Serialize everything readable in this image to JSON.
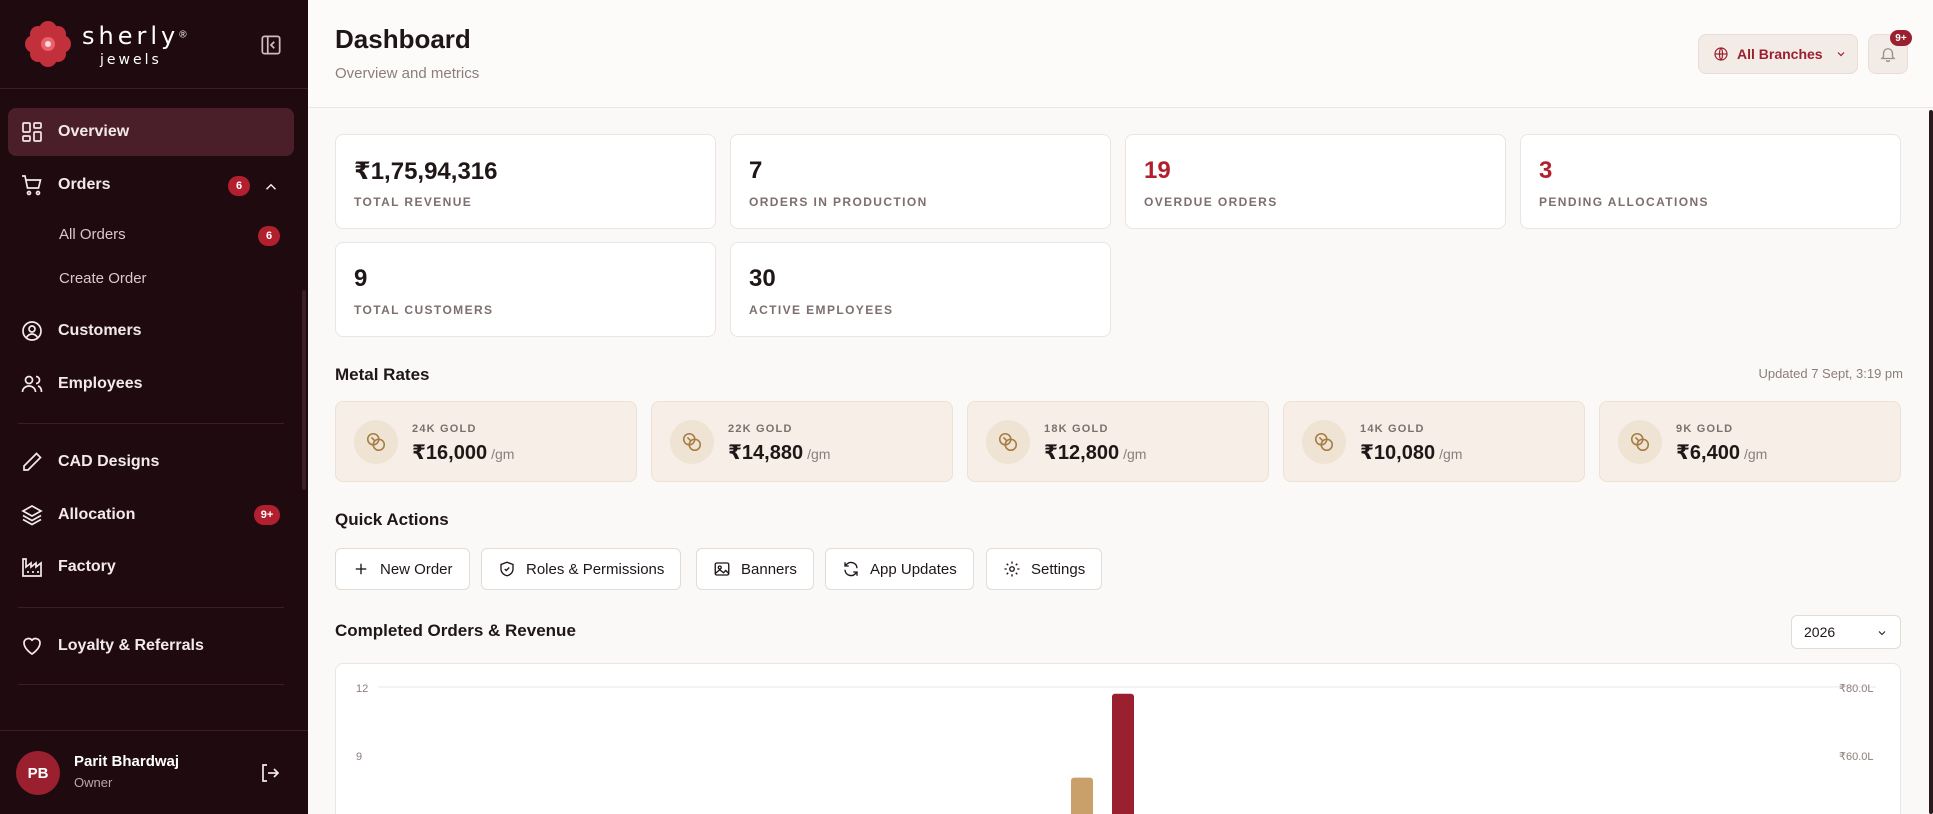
{
  "brand": {
    "name": "sherly",
    "tagline": "jewels",
    "reg": "®"
  },
  "sidebar": {
    "items": [
      {
        "label": "Overview"
      },
      {
        "label": "Orders",
        "badge": "6"
      },
      {
        "label": "Customers"
      },
      {
        "label": "Employees"
      },
      {
        "label": "CAD Designs"
      },
      {
        "label": "Allocation",
        "badge": "9+"
      },
      {
        "label": "Factory"
      },
      {
        "label": "Loyalty & Referrals"
      }
    ],
    "orders_sub": [
      {
        "label": "All Orders",
        "badge": "6"
      },
      {
        "label": "Create Order"
      }
    ]
  },
  "user": {
    "initials": "PB",
    "name": "Parit Bhardwaj",
    "role": "Owner"
  },
  "header": {
    "title": "Dashboard",
    "subtitle": "Overview and metrics",
    "branch": "All Branches",
    "notifications_badge": "9+"
  },
  "stats": [
    {
      "value": "₹1,75,94,316",
      "label": "TOTAL REVENUE"
    },
    {
      "value": "7",
      "label": "ORDERS IN PRODUCTION"
    },
    {
      "value": "19",
      "label": "OVERDUE ORDERS"
    },
    {
      "value": "3",
      "label": "PENDING ALLOCATIONS"
    },
    {
      "value": "9",
      "label": "TOTAL CUSTOMERS"
    },
    {
      "value": "30",
      "label": "ACTIVE EMPLOYEES"
    }
  ],
  "metal_rates": {
    "title": "Metal Rates",
    "updated": "Updated 7 Sept, 3:19 pm",
    "unit": "/gm",
    "items": [
      {
        "label": "24K GOLD",
        "value": "₹16,000"
      },
      {
        "label": "22K GOLD",
        "value": "₹14,880"
      },
      {
        "label": "18K GOLD",
        "value": "₹12,800"
      },
      {
        "label": "14K GOLD",
        "value": "₹10,080"
      },
      {
        "label": "9K GOLD",
        "value": "₹6,400"
      }
    ]
  },
  "quick_actions": {
    "title": "Quick Actions",
    "items": [
      {
        "label": "New Order",
        "icon": "plus-icon"
      },
      {
        "label": "Roles & Permissions",
        "icon": "shield-icon"
      },
      {
        "label": "Banners",
        "icon": "image-icon"
      },
      {
        "label": "App Updates",
        "icon": "refresh-icon"
      },
      {
        "label": "Settings",
        "icon": "gear-icon"
      }
    ]
  },
  "colors": {
    "brand": "#9a2030",
    "gold": "#c9a06a",
    "sidebar": "#1e0a0f"
  },
  "chart_data": {
    "type": "bar",
    "title": "Completed Orders & Revenue",
    "year": "2026",
    "left_ticks": [
      "12",
      "9"
    ],
    "right_ticks": [
      "₹80.0L",
      "₹60.0L"
    ],
    "grid": true,
    "series": [
      {
        "values": [
          8
        ],
        "color": "#c9a06a"
      },
      {
        "values": [
          78
        ],
        "color": "#9a2030"
      }
    ]
  }
}
